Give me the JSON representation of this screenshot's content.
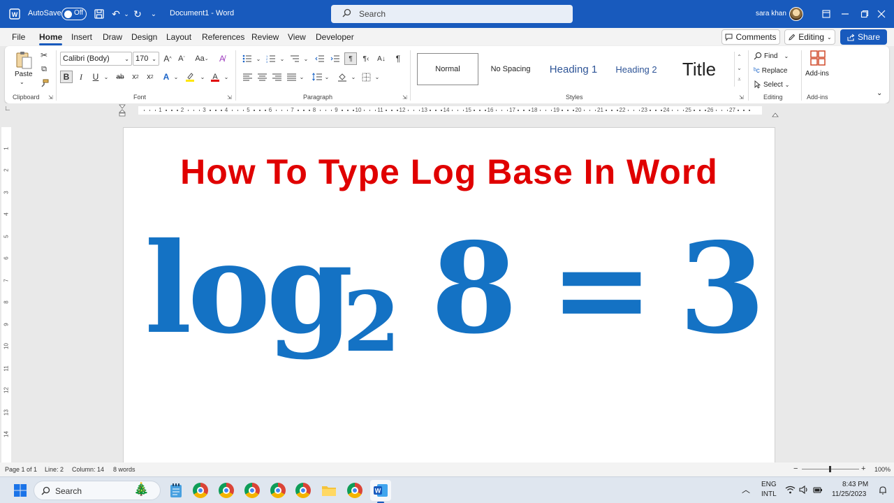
{
  "titlebar": {
    "autosave_label": "AutoSave",
    "autosave_state": "Off",
    "document_title": "Document1 - Word",
    "search_placeholder": "Search",
    "user_name": "sara khan"
  },
  "menu": {
    "tabs": [
      "File",
      "Home",
      "Insert",
      "Draw",
      "Design",
      "Layout",
      "References",
      "Review",
      "View",
      "Developer"
    ],
    "active_tab": "Home",
    "comments_label": "Comments",
    "editing_label": "Editing",
    "share_label": "Share"
  },
  "ribbon": {
    "clipboard": {
      "paste_label": "Paste",
      "group_label": "Clipboard"
    },
    "font": {
      "font_name": "Calibri (Body)",
      "font_size": "170",
      "group_label": "Font",
      "case_label": "Aa"
    },
    "paragraph": {
      "group_label": "Paragraph"
    },
    "styles": {
      "items": [
        "Normal",
        "No Spacing",
        "Heading 1",
        "Heading 2",
        "Title"
      ],
      "group_label": "Styles"
    },
    "editing": {
      "find_label": "Find",
      "replace_label": "Replace",
      "select_label": "Select",
      "group_label": "Editing"
    },
    "addins": {
      "addins_label": "Add-ins",
      "group_label": "Add-ins"
    }
  },
  "document": {
    "heading": "How To Type Log Base In Word",
    "equation": {
      "function": "log",
      "base": "2",
      "argument": "8",
      "operator": "=",
      "result": "3"
    },
    "heading_color": "#e00000",
    "equation_color": "#1472c4"
  },
  "statusbar": {
    "page": "Page 1 of 1",
    "line": "Line: 2",
    "column": "Column: 14",
    "words": "8 words",
    "zoom": "100%"
  },
  "taskbar": {
    "search_placeholder": "Search",
    "language_line1": "ENG",
    "language_line2": "INTL",
    "time": "8:43 PM",
    "date": "11/25/2023"
  },
  "colors": {
    "brand": "#185abd"
  }
}
